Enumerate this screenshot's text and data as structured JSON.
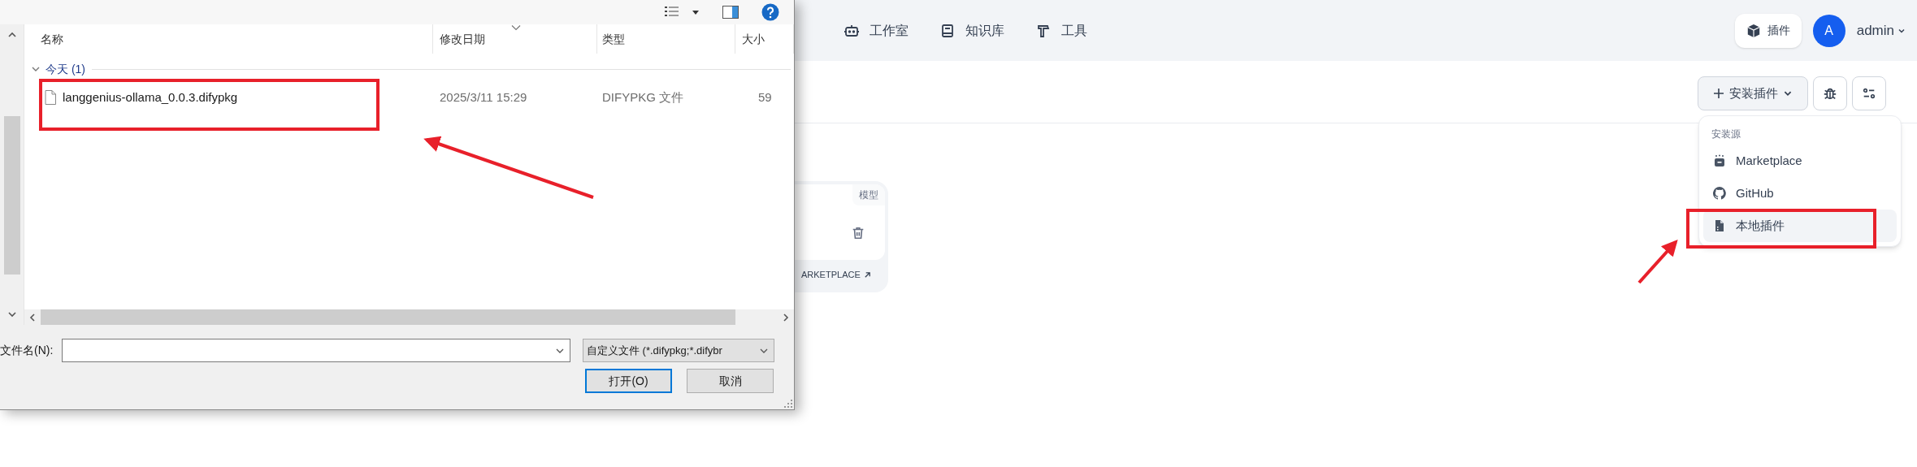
{
  "file_dialog": {
    "columns": [
      "名称",
      "修改日期",
      "类型",
      "大小"
    ],
    "groups": [
      {
        "label": "今天 (1)",
        "expanded": true,
        "files": [
          {
            "name": "langgenius-ollama_0.0.3.difypkg",
            "modified": "2025/3/11 15:29",
            "type": "DIFYPKG 文件",
            "size": "59"
          }
        ]
      }
    ],
    "file_name_label": "文件名(N):",
    "file_type_filter": "自定义文件 (*.difypkg;*.difybr",
    "buttons": [
      {
        "label": "打开(O)",
        "default": true
      },
      {
        "label": "取消",
        "default": false
      }
    ]
  },
  "nav": {
    "items": [
      {
        "label": "工作室"
      },
      {
        "label": "知识库"
      },
      {
        "label": "工具"
      }
    ]
  },
  "plugins_button": "插件",
  "user": {
    "avatar_letter": "A",
    "name": "admin"
  },
  "install_button": "安装插件",
  "install_menu": {
    "heading": "安装源",
    "items": [
      {
        "label": "Marketplace",
        "selected": false
      },
      {
        "label": "GitHub",
        "selected": false
      },
      {
        "label": "本地插件",
        "selected": true
      }
    ]
  },
  "plugin_card": {
    "tag": "模型",
    "link": "ARKETPLACE"
  }
}
